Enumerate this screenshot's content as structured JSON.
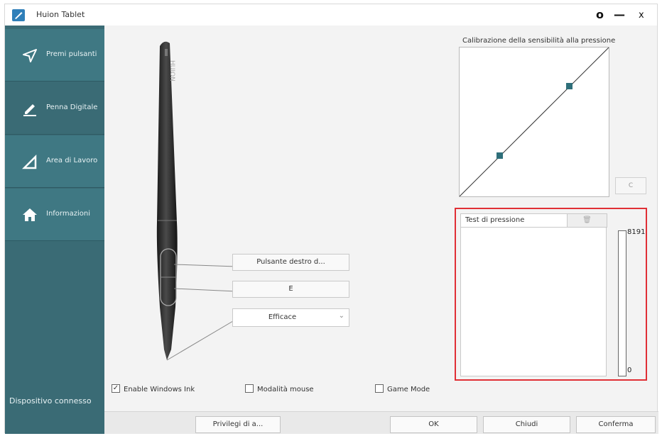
{
  "window": {
    "title": "Huion Tablet",
    "controls": [
      "o",
      "—",
      "x"
    ]
  },
  "sidebar": {
    "items": [
      {
        "label": "Premi pulsanti",
        "icon": "send-icon",
        "active": false
      },
      {
        "label": "Penna Digitale",
        "icon": "pen-icon",
        "active": true
      },
      {
        "label": "Area di Lavoro",
        "icon": "area-icon",
        "active": false
      },
      {
        "label": "Informazioni",
        "icon": "home-icon",
        "active": false
      }
    ],
    "device_status": "Dispositivo connesso"
  },
  "pen_settings": {
    "upper_button": "Pulsante destro d...",
    "lower_button": "E",
    "tip_mode": "Efficace"
  },
  "calibration": {
    "title": "Calibrazione della sensibilità alla pressione",
    "reset_label": "C"
  },
  "pressure_test": {
    "title": "Test di pressione",
    "clear_icon": "trash-icon",
    "max_value": "8191",
    "min_value": "0"
  },
  "options": {
    "windows_ink": {
      "label": "Enable Windows Ink",
      "checked": true
    },
    "mouse_mode": {
      "label": "Modalità mouse",
      "checked": false
    },
    "game_mode": {
      "label": "Game Mode",
      "checked": false
    }
  },
  "footer": {
    "privileges": "Privilegi di a...",
    "ok": "OK",
    "close": "Chiudi",
    "confirm": "Conferma"
  },
  "colors": {
    "sidebar": "#3a6b75",
    "accent": "#2f7fb9",
    "highlight_border": "#e02f35"
  }
}
